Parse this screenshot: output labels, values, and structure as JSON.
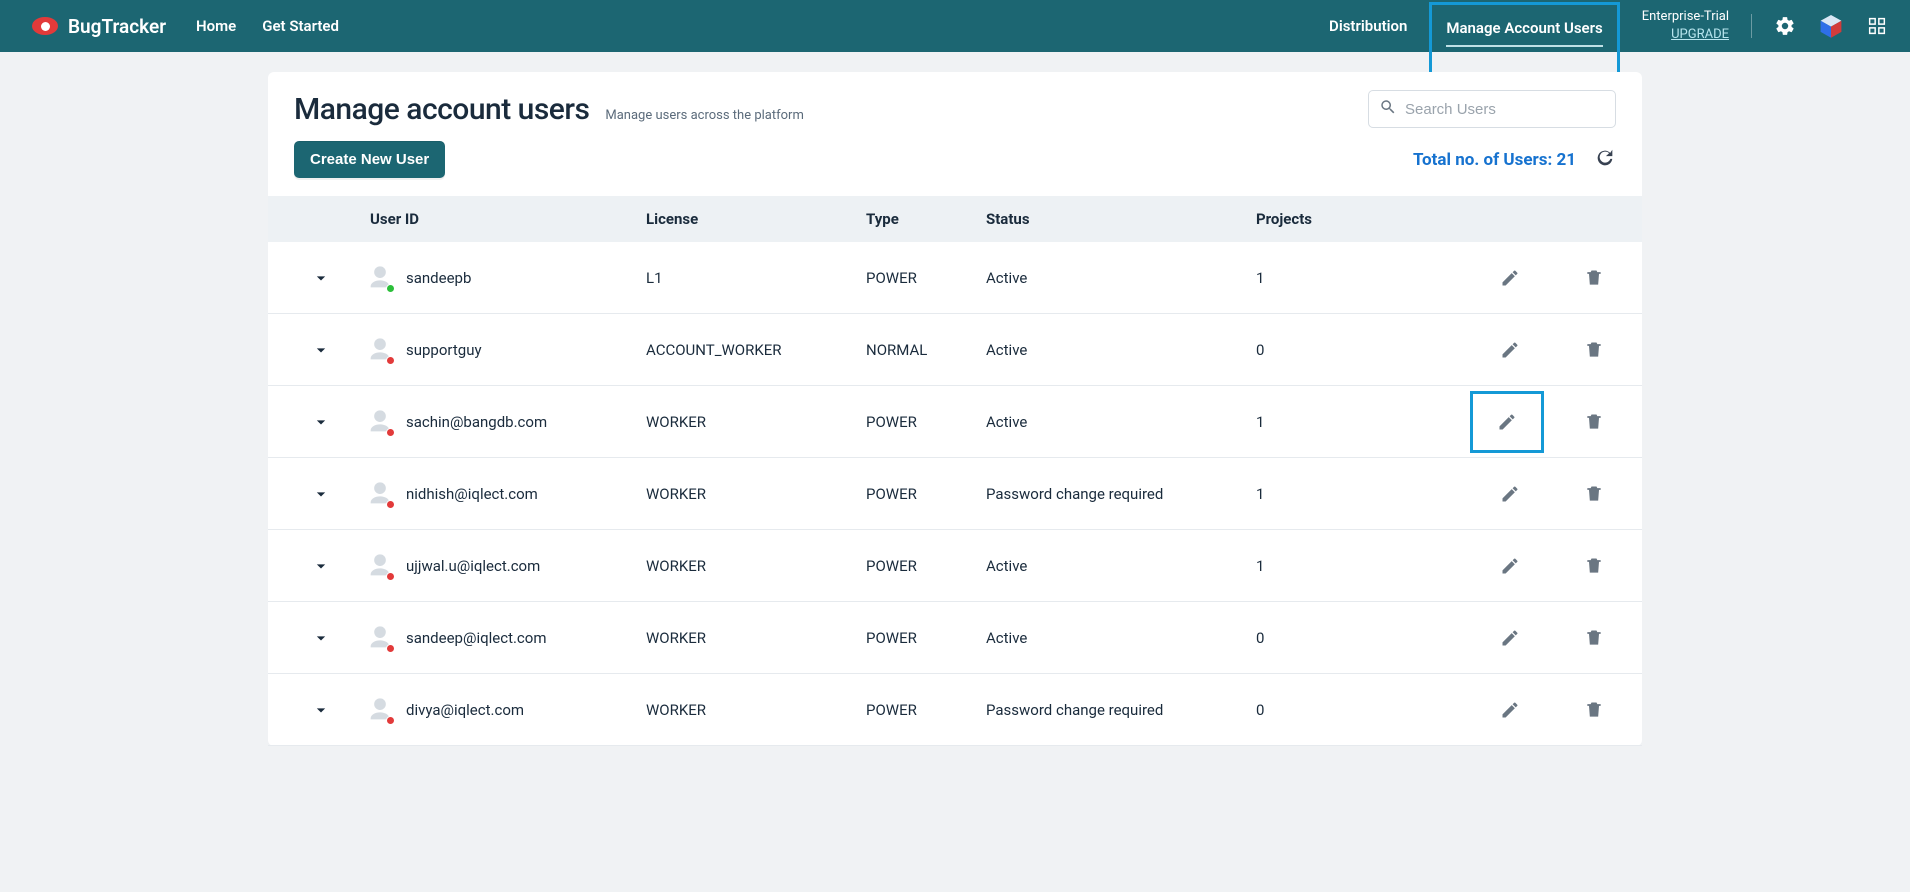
{
  "header": {
    "appName": "BugTracker",
    "navLeft": [
      "Home",
      "Get Started"
    ],
    "navRight": {
      "distribution": "Distribution",
      "manage": "Manage Account Users",
      "plan": "Enterprise-Trial",
      "upgrade": "UPGRADE"
    }
  },
  "page": {
    "title": "Manage account users",
    "subtitle": "Manage users across the platform",
    "searchPlaceholder": "Search Users",
    "createBtn": "Create New User",
    "totalLabel": "Total no. of Users: 21"
  },
  "columns": {
    "user": "User ID",
    "license": "License",
    "type": "Type",
    "status": "Status",
    "projects": "Projects"
  },
  "users": [
    {
      "id": "sandeepb",
      "license": "L1",
      "type": "POWER",
      "status": "Active",
      "projects": "1",
      "online": true,
      "editHighlight": false
    },
    {
      "id": "supportguy",
      "license": "ACCOUNT_WORKER",
      "type": "NORMAL",
      "status": "Active",
      "projects": "0",
      "online": false,
      "editHighlight": false
    },
    {
      "id": "sachin@bangdb.com",
      "license": "WORKER",
      "type": "POWER",
      "status": "Active",
      "projects": "1",
      "online": false,
      "editHighlight": true
    },
    {
      "id": "nidhish@iqlect.com",
      "license": "WORKER",
      "type": "POWER",
      "status": "Password change required",
      "projects": "1",
      "online": false,
      "editHighlight": false
    },
    {
      "id": "ujjwal.u@iqlect.com",
      "license": "WORKER",
      "type": "POWER",
      "status": "Active",
      "projects": "1",
      "online": false,
      "editHighlight": false
    },
    {
      "id": "sandeep@iqlect.com",
      "license": "WORKER",
      "type": "POWER",
      "status": "Active",
      "projects": "0",
      "online": false,
      "editHighlight": false
    },
    {
      "id": "divya@iqlect.com",
      "license": "WORKER",
      "type": "POWER",
      "status": "Password change required",
      "projects": "0",
      "online": false,
      "editHighlight": false
    }
  ]
}
